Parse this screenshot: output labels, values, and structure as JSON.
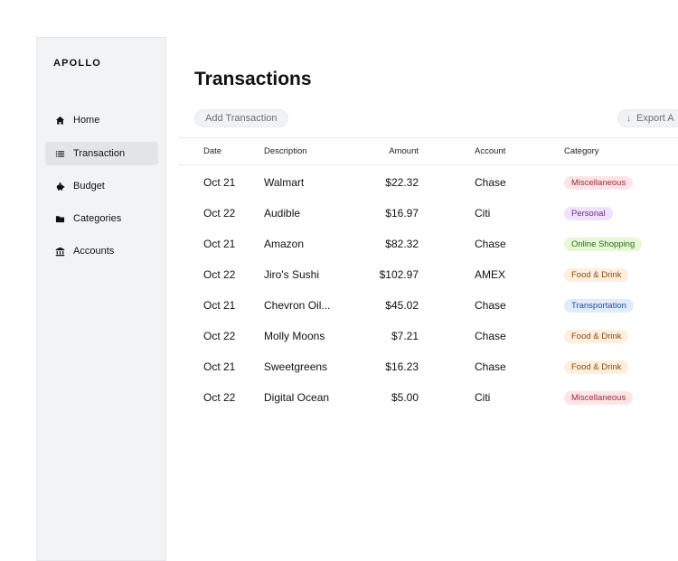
{
  "app": {
    "brand": "APOLLO"
  },
  "sidebar": {
    "items": [
      {
        "label": "Home",
        "icon": "home-icon",
        "active": false
      },
      {
        "label": "Transaction",
        "icon": "list-icon",
        "active": true
      },
      {
        "label": "Budget",
        "icon": "piggy-bank-icon",
        "active": false
      },
      {
        "label": "Categories",
        "icon": "folder-icon",
        "active": false
      },
      {
        "label": "Accounts",
        "icon": "bank-icon",
        "active": false
      }
    ]
  },
  "main": {
    "title": "Transactions",
    "add_button": "Add Transaction",
    "export_button": "Export A",
    "export_icon": "arrow-down-icon"
  },
  "table": {
    "columns": [
      "Date",
      "Description",
      "Amount",
      "Account",
      "Category"
    ],
    "rows": [
      {
        "date": "Oct 21",
        "description": "Walmart",
        "amount": "$22.32",
        "account": "Chase",
        "category": "Miscellaneous"
      },
      {
        "date": "Oct 22",
        "description": "Audible",
        "amount": "$16.97",
        "account": "Citi",
        "category": "Personal"
      },
      {
        "date": "Oct 21",
        "description": "Amazon",
        "amount": "$82.32",
        "account": "Chase",
        "category": "Online Shopping"
      },
      {
        "date": "Oct 22",
        "description": "Jiro's Sushi",
        "amount": "$102.97",
        "account": "AMEX",
        "category": "Food & Drink"
      },
      {
        "date": "Oct 21",
        "description": "Chevron Oil...",
        "amount": "$45.02",
        "account": "Chase",
        "category": "Transportation"
      },
      {
        "date": "Oct 22",
        "description": "Molly Moons",
        "amount": "$7.21",
        "account": "Chase",
        "category": "Food & Drink"
      },
      {
        "date": "Oct 21",
        "description": "Sweetgreens",
        "amount": "$16.23",
        "account": "Chase",
        "category": "Food & Drink"
      },
      {
        "date": "Oct 22",
        "description": "Digital Ocean",
        "amount": "$5.00",
        "account": "Citi",
        "category": "Miscellaneous"
      }
    ]
  },
  "category_colors": {
    "Miscellaneous": {
      "bg": "#fde4e6",
      "fg": "#9c2a3a"
    },
    "Personal": {
      "bg": "#f1e2fb",
      "fg": "#6b2c8c"
    },
    "Online Shopping": {
      "bg": "#e6f8d6",
      "fg": "#2f6a1d"
    },
    "Food & Drink": {
      "bg": "#fdeedd",
      "fg": "#8a4b14"
    },
    "Transportation": {
      "bg": "#e0ecfd",
      "fg": "#24508f"
    }
  }
}
